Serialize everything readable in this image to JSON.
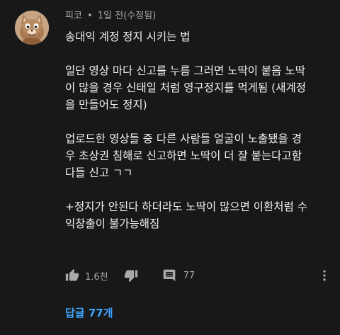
{
  "comment": {
    "author": "피코",
    "separator": "•",
    "time": "1일 전(수정됨)",
    "paragraphs": [
      [
        "송대익 계정 정지 시키는 법"
      ],
      [
        "일단 영상 마다 신고를 누름 그러면 노딱이 붙음 노딱",
        "이 많을 경우 신태일 처럼 영구정지를 먹게됨 (새계정",
        "을 만들어도 정지)"
      ],
      [
        "업로드한 영상들 중 다른 사람들 얼굴이 노출됐을 경",
        "우 초상권 침해로 신고하면 노딱이 더 잘 붙는다고함",
        "다들 신고 ㄱㄱ"
      ],
      [
        "+정지가 안된다 하더라도 노딱이 많으면 이환처럼 수",
        "익창출이 불가능해짐"
      ]
    ]
  },
  "actions": {
    "like_count": "1.6천",
    "reply_count": "77",
    "icons": [
      "thumbs-up-icon",
      "thumbs-down-icon",
      "comment-icon",
      "more-vert-icon"
    ]
  },
  "replies_link": "답글 77개",
  "colors": {
    "background": "#181818",
    "text": "#f1f1f1",
    "meta": "#aaaaaa",
    "link": "#3ea6ff"
  }
}
